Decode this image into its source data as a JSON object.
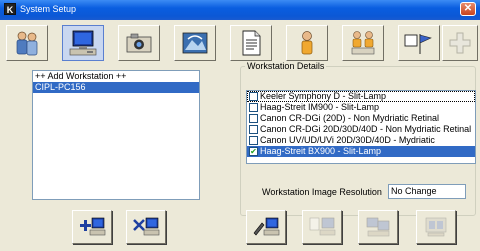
{
  "window": {
    "title": "System Setup",
    "app_icon_glyph": "K",
    "close_glyph": "✕"
  },
  "toolbar": {
    "buttons": [
      {
        "icon": "users-icon",
        "active": false
      },
      {
        "icon": "workstation-icon",
        "active": true
      },
      {
        "icon": "camera-icon",
        "active": false
      },
      {
        "icon": "eye-image-icon",
        "active": false
      },
      {
        "icon": "document-icon",
        "active": false
      },
      {
        "icon": "person-icon",
        "active": false
      },
      {
        "icon": "group-icon",
        "active": false
      },
      {
        "icon": "flag-icon",
        "active": false
      },
      {
        "icon": "add-cross-icon",
        "active": false
      }
    ]
  },
  "workstations": {
    "items": [
      {
        "label": "++ Add Workstation ++",
        "selected": false
      },
      {
        "label": "CIPL-PC156",
        "selected": true
      }
    ]
  },
  "details": {
    "legend": "Workstation Details",
    "devices": [
      {
        "label": "Keeler Symphony D - Slit-Lamp",
        "checked": false,
        "selected": false
      },
      {
        "label": "Haag-Streit IM900 - Slit-Lamp",
        "checked": false,
        "selected": false
      },
      {
        "label": "Canon CR-DGi (20D) - Non Mydriatic Retinal",
        "checked": false,
        "selected": false
      },
      {
        "label": "Canon CR-DGi 20D/30D/40D - Non Mydriatic Retinal",
        "checked": false,
        "selected": false
      },
      {
        "label": "Canon UV/UD/UVi 20D/30D/40D - Mydriatic",
        "checked": false,
        "selected": false
      },
      {
        "label": "Haag-Streit BX900 - Slit-Lamp",
        "checked": true,
        "selected": true
      }
    ],
    "resolution_label": "Workstation Image Resolution",
    "resolution_value": "No Change"
  },
  "colors": {
    "selection": "#316ac5",
    "titlebar": "#0a5ee0",
    "face": "#ece9d8"
  }
}
